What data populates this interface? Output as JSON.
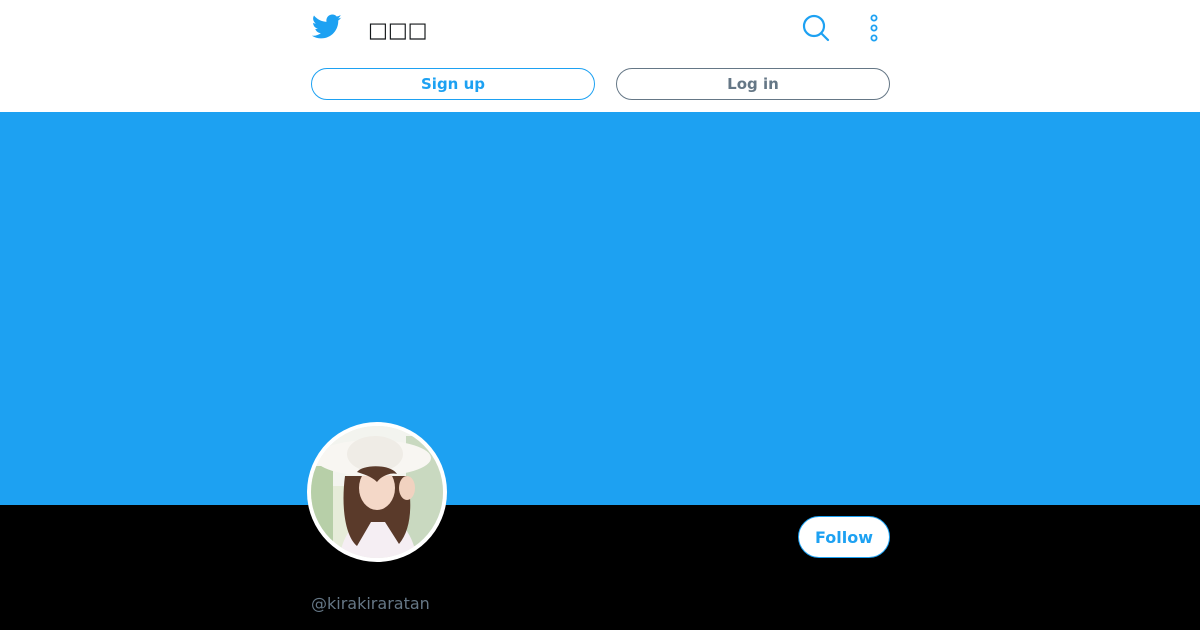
{
  "header": {
    "title": "□□□",
    "logo_icon": "twitter-bird-icon",
    "search_icon": "search-icon",
    "more_icon": "more-vertical-icon"
  },
  "actions": {
    "signup_label": "Sign up",
    "login_label": "Log in"
  },
  "profile": {
    "follow_label": "Follow",
    "handle": "@kirakiraratan"
  },
  "colors": {
    "accent": "#1da1f2",
    "banner": "#1da1f2",
    "muted": "#657786",
    "background": "#000000"
  }
}
